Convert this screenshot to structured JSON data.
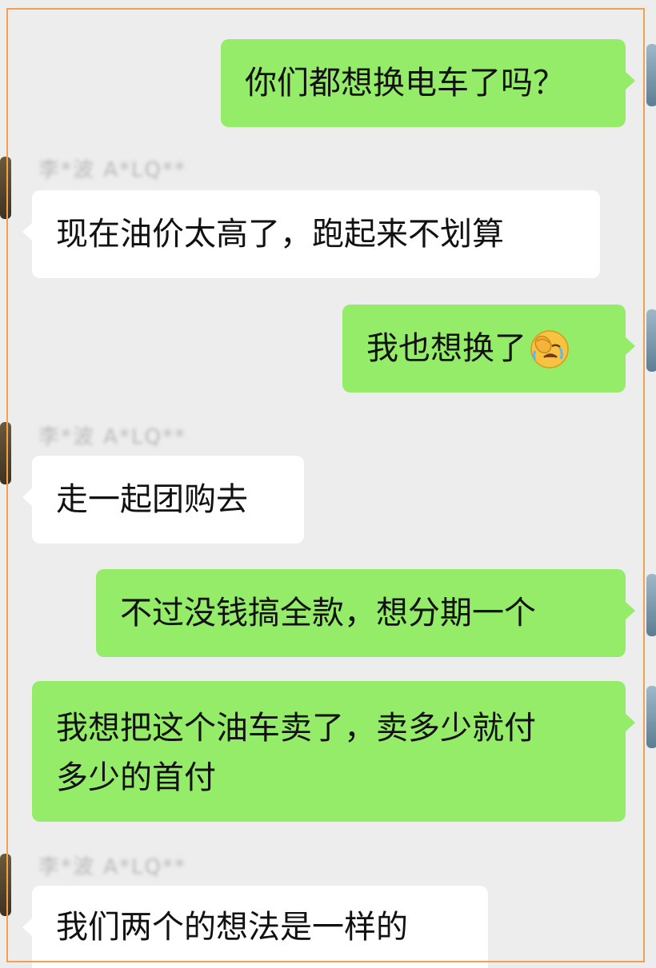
{
  "chat": {
    "messages": [
      {
        "id": "m1",
        "side": "out",
        "text": "你们都想换电车了吗？"
      },
      {
        "id": "m2",
        "side": "in",
        "sender": "李*波 A*LQ**",
        "text": "现在油价太高了，跑起来不划算"
      },
      {
        "id": "m3",
        "side": "out",
        "text": "我也想换了",
        "emoji": "facepalm-crying-emoji"
      },
      {
        "id": "m4",
        "side": "in",
        "sender": "李*波 A*LQ**",
        "text": "走一起团购去"
      },
      {
        "id": "m5",
        "side": "out",
        "text": "不过没钱搞全款，想分期一个"
      },
      {
        "id": "m6",
        "side": "out",
        "lines": [
          "我想把这个油车卖了，卖多少就付",
          "多少的首付"
        ]
      },
      {
        "id": "m7",
        "side": "in",
        "sender": "李*波 A*LQ**",
        "text": "我们两个的想法是一样的"
      }
    ]
  },
  "colors": {
    "outgoing_bubble": "#95ec69",
    "incoming_bubble": "#ffffff",
    "background": "#ededed",
    "frame_border": "#f0a050"
  }
}
